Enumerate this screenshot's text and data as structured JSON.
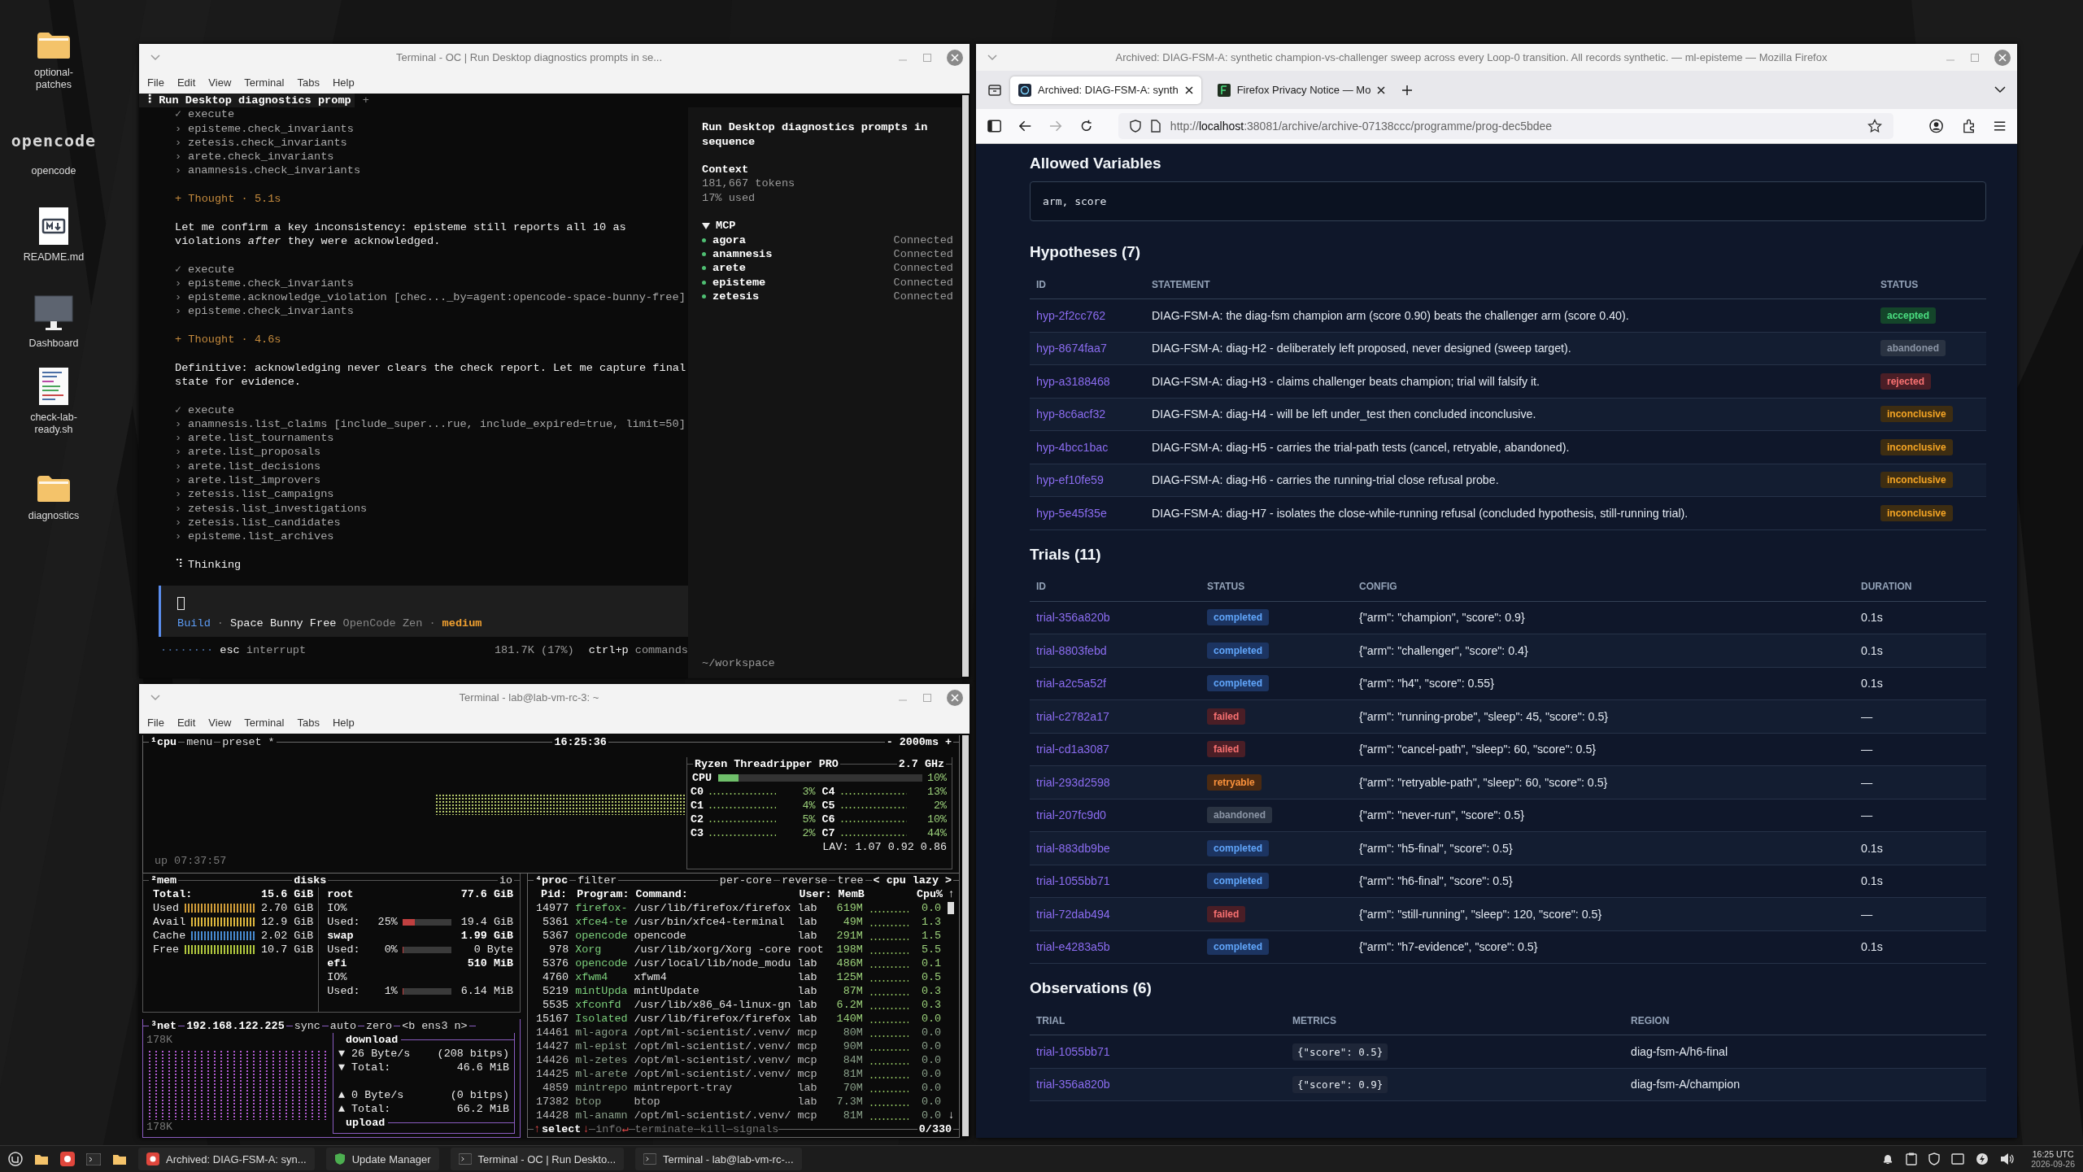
{
  "desktop": {
    "icons": [
      {
        "kind": "folder",
        "label": "optional-patches"
      },
      {
        "kind": "logo",
        "logo_text": "opencode",
        "label": "opencode"
      },
      {
        "kind": "markdown",
        "label": "README.md"
      },
      {
        "kind": "monitor",
        "label": "Dashboard"
      },
      {
        "kind": "script",
        "label": "check-lab-ready.sh"
      },
      {
        "kind": "folder",
        "label": "diagnostics"
      }
    ]
  },
  "opencode_window": {
    "title": "Terminal - OC | Run Desktop diagnostics prompts in se...",
    "menu": [
      "File",
      "Edit",
      "View",
      "Terminal",
      "Tabs",
      "Help"
    ],
    "session_tab": {
      "spinner": "⠸",
      "label": "Run Desktop diagnostics promp"
    },
    "new_tab": "+",
    "transcript": [
      {
        "kind": "execute",
        "mark": "✓",
        "text": "execute"
      },
      {
        "kind": "tool",
        "mark": "›",
        "text": "episteme.check_invariants"
      },
      {
        "kind": "tool",
        "mark": "›",
        "text": "zetesis.check_invariants"
      },
      {
        "kind": "tool",
        "mark": "›",
        "text": "arete.check_invariants"
      },
      {
        "kind": "tool",
        "mark": "›",
        "text": "anamnesis.check_invariants"
      },
      {
        "kind": "thought",
        "text": "+ Thought · 5.1s"
      },
      {
        "kind": "message",
        "text": "Let me confirm a key inconsistency: episteme still reports all 10 as violations *after* they were acknowledged."
      },
      {
        "kind": "execute",
        "mark": "✓",
        "text": "execute"
      },
      {
        "kind": "tool",
        "mark": "›",
        "text": "episteme.check_invariants"
      },
      {
        "kind": "tool",
        "mark": "›",
        "text": "episteme.acknowledge_violation [chec..._by=agent:opencode-space-bunny-free]"
      },
      {
        "kind": "tool",
        "mark": "›",
        "text": "episteme.check_invariants"
      },
      {
        "kind": "thought",
        "text": "+ Thought · 4.6s"
      },
      {
        "kind": "message",
        "text": "Definitive: acknowledging never clears the check report. Let me capture final state for evidence."
      },
      {
        "kind": "execute",
        "mark": "✓",
        "text": "execute"
      },
      {
        "kind": "tool",
        "mark": "›",
        "text": "anamnesis.list_claims [include_super...rue, include_expired=true, limit=50]"
      },
      {
        "kind": "tool",
        "mark": "›",
        "text": "arete.list_tournaments"
      },
      {
        "kind": "tool",
        "mark": "›",
        "text": "arete.list_proposals"
      },
      {
        "kind": "tool",
        "mark": "›",
        "text": "arete.list_decisions"
      },
      {
        "kind": "tool",
        "mark": "›",
        "text": "arete.list_improvers"
      },
      {
        "kind": "tool",
        "mark": "›",
        "text": "zetesis.list_campaigns"
      },
      {
        "kind": "tool",
        "mark": "›",
        "text": "zetesis.list_investigations"
      },
      {
        "kind": "tool",
        "mark": "›",
        "text": "zetesis.list_candidates"
      },
      {
        "kind": "tool",
        "mark": "›",
        "text": "episteme.list_archives"
      },
      {
        "kind": "thinking",
        "mark": "⠹",
        "text": "Thinking"
      }
    ],
    "prompt": {
      "agent": "Build",
      "separator": "·",
      "model": "Space Bunny Free",
      "provider": "OpenCode Zen",
      "variant": "medium"
    },
    "status": {
      "spinner": "········",
      "key": "esc",
      "action": "interrupt",
      "usage": "181.7K (17%)",
      "shortcut": "ctrl+p",
      "shortcut_action": "commands"
    },
    "sidebar": {
      "title": "Run Desktop diagnostics prompts in sequence",
      "context_label": "Context",
      "tokens": "181,667 tokens",
      "used": "17% used",
      "mcp": {
        "label": "MCP",
        "expanded": true,
        "servers": [
          {
            "name": "agora",
            "status": "Connected",
            "color": "#4fbf73"
          },
          {
            "name": "anamnesis",
            "status": "Connected",
            "color": "#4fbf73"
          },
          {
            "name": "arete",
            "status": "Connected",
            "color": "#4fbf73"
          },
          {
            "name": "episteme",
            "status": "Connected",
            "color": "#4fbf73"
          },
          {
            "name": "zetesis",
            "status": "Connected",
            "color": "#4fbf73"
          }
        ]
      },
      "cwd": "~/workspace"
    }
  },
  "btop_window": {
    "title": "Terminal - lab@lab-vm-rc-3: ~",
    "menu": [
      "File",
      "Edit",
      "View",
      "Terminal",
      "Tabs",
      "Help"
    ],
    "cpu": {
      "title": "¹cpu",
      "menu": "menu",
      "preset": "preset *",
      "clock": "16:25:36",
      "interval": "- 2000ms +",
      "uptime": "up 07:37:57",
      "model": "Ryzen Threadripper PRO",
      "freq": "2.7 GHz",
      "total": {
        "label": "CPU",
        "level": 0.1,
        "reading": "10%"
      },
      "cores": [
        {
          "label": "C0",
          "reading": "3%"
        },
        {
          "label": "C1",
          "reading": "4%"
        },
        {
          "label": "C2",
          "reading": "5%"
        },
        {
          "label": "C3",
          "reading": "2%"
        },
        {
          "label": "C4",
          "reading": "13%"
        },
        {
          "label": "C5",
          "reading": "2%"
        },
        {
          "label": "C6",
          "reading": "10%"
        },
        {
          "label": "C7",
          "reading": "44%"
        }
      ],
      "load": "LAV: 1.07 0.92 0.86"
    },
    "mem": {
      "title": "²mem",
      "rows": [
        {
          "label": "Total:",
          "value": "15.6 GiB"
        },
        {
          "label": "Used",
          "value": "2.70 GiB",
          "color": "#d9a33a"
        },
        {
          "label": "Avail",
          "value": "12.9 GiB",
          "color": "#e8c040"
        },
        {
          "label": "Cache",
          "value": "2.02 GiB",
          "color": "#4a8fd8"
        },
        {
          "label": "Free",
          "value": "10.7 GiB",
          "color": "#b8d040"
        }
      ]
    },
    "disks": {
      "title": "disks",
      "io": "io",
      "rows": [
        {
          "kind": "head",
          "label": "root",
          "value": "77.6 GiB"
        },
        {
          "kind": "io",
          "label": "IO%"
        },
        {
          "kind": "used",
          "label": "Used:",
          "percent": "25%",
          "level": 0.25,
          "value": "19.4 GiB"
        },
        {
          "kind": "head",
          "label": "swap",
          "value": "1.99 GiB"
        },
        {
          "kind": "used",
          "label": "Used:",
          "percent": "0%",
          "level": 0,
          "value": "0 Byte"
        },
        {
          "kind": "head",
          "label": "efi",
          "value": "510 MiB"
        },
        {
          "kind": "io",
          "label": "IO%"
        },
        {
          "kind": "used",
          "label": "Used:",
          "percent": "1%",
          "level": 0.01,
          "value": "6.14 MiB"
        }
      ]
    },
    "net": {
      "title": "³net",
      "address": "192.168.122.225",
      "options": [
        "sync",
        "auto",
        "zero"
      ],
      "interface": "<b ens3 n>",
      "scale_top": "178K",
      "scale_bottom": "178K",
      "download": {
        "label": "download",
        "rate": "▼ 26 Byte/s",
        "bits": "(208 bitps)",
        "total_label": "▼ Total:",
        "total": "46.6 MiB"
      },
      "upload": {
        "label": "upload",
        "rate": "▲ 0 Byte/s",
        "bits": "(0 bitps)",
        "total_label": "▲ Total:",
        "total": "66.2 MiB"
      }
    },
    "proc": {
      "title": "⁴proc",
      "filter": "filter",
      "options": [
        "per-core",
        "reverse",
        "tree"
      ],
      "sort": "< cpu lazy >",
      "columns": [
        "Pid:",
        "Program:",
        "Command:",
        "User:",
        "MemB",
        "Cpu%"
      ],
      "scroll_up": "↑",
      "scroll_down": "↓",
      "rows": [
        {
          "pid": "14977",
          "program": "firefox-",
          "command": "/usr/lib/firefox/firefox",
          "user": "lab",
          "mem": "619M",
          "cpu": "0.0"
        },
        {
          "pid": "5361",
          "program": "xfce4-te",
          "command": "/usr/bin/xfce4-terminal",
          "user": "lab",
          "mem": "49M",
          "cpu": "1.3"
        },
        {
          "pid": "5367",
          "program": "opencode",
          "command": "opencode",
          "user": "lab",
          "mem": "291M",
          "cpu": "1.5"
        },
        {
          "pid": "978",
          "program": "Xorg",
          "command": "/usr/lib/xorg/Xorg -core",
          "user": "root",
          "mem": "198M",
          "cpu": "5.5"
        },
        {
          "pid": "5376",
          "program": "opencode",
          "command": "/usr/local/lib/node_modu",
          "user": "lab",
          "mem": "486M",
          "cpu": "0.1"
        },
        {
          "pid": "4760",
          "program": "xfwm4",
          "command": "xfwm4",
          "user": "lab",
          "mem": "125M",
          "cpu": "0.5"
        },
        {
          "pid": "5219",
          "program": "mintUpda",
          "command": "mintUpdate",
          "user": "lab",
          "mem": "87M",
          "cpu": "0.3"
        },
        {
          "pid": "5535",
          "program": "xfconfd",
          "command": "/usr/lib/x86_64-linux-gn",
          "user": "lab",
          "mem": "6.2M",
          "cpu": "0.3"
        },
        {
          "pid": "15167",
          "program": "Isolated",
          "command": "/usr/lib/firefox/firefox",
          "user": "lab",
          "mem": "140M",
          "cpu": "0.0"
        },
        {
          "pid": "14461",
          "program": "ml-agora",
          "command": "/opt/ml-scientist/.venv/",
          "user": "mcp",
          "mem": "80M",
          "cpu": "0.0"
        },
        {
          "pid": "14427",
          "program": "ml-epist",
          "command": "/opt/ml-scientist/.venv/",
          "user": "mcp",
          "mem": "90M",
          "cpu": "0.0"
        },
        {
          "pid": "14426",
          "program": "ml-zetes",
          "command": "/opt/ml-scientist/.venv/",
          "user": "mcp",
          "mem": "84M",
          "cpu": "0.0"
        },
        {
          "pid": "14425",
          "program": "ml-arete",
          "command": "/opt/ml-scientist/.venv/",
          "user": "mcp",
          "mem": "81M",
          "cpu": "0.0"
        },
        {
          "pid": "4859",
          "program": "mintrepo",
          "command": "mintreport-tray",
          "user": "lab",
          "mem": "70M",
          "cpu": "0.0"
        },
        {
          "pid": "17382",
          "program": "btop",
          "command": "btop",
          "user": "lab",
          "mem": "7.3M",
          "cpu": "0.0"
        },
        {
          "pid": "14428",
          "program": "ml-anamn",
          "command": "/opt/ml-scientist/.venv/",
          "user": "mcp",
          "mem": "81M",
          "cpu": "0.0"
        }
      ],
      "footer": {
        "up": "↑",
        "select": "select",
        "down": "↓",
        "info": "info",
        "enter": "↵",
        "terminate": "terminate",
        "kill": "kill",
        "signals": "signals",
        "count": "0/330"
      }
    }
  },
  "browser": {
    "title": "Archived: DIAG-FSM-A: synthetic champion-vs-challenger sweep across every Loop-0 transition. All records synthetic. — ml-episteme — Mozilla Firefox",
    "tabs": [
      {
        "title": "Archived: DIAG-FSM-A: synth",
        "selected": true
      },
      {
        "title": "Firefox Privacy Notice — Mo",
        "selected": false
      }
    ],
    "url": {
      "scheme": "http://",
      "host": "localhost",
      "rest": ":38081/archive/archive-07138ccc/programme/prog-dec5bdee"
    },
    "page": {
      "allowed_variables": {
        "heading": "Allowed Variables",
        "value": "arm, score"
      },
      "hypotheses": {
        "heading": "Hypotheses (7)",
        "columns": [
          "ID",
          "STATEMENT",
          "STATUS"
        ],
        "rows": [
          {
            "id": "hyp-2f2cc762",
            "statement": "DIAG-FSM-A: the diag-fsm champion arm (score 0.90) beats the challenger arm (score 0.40).",
            "status": "accepted",
            "kind": "accepted"
          },
          {
            "id": "hyp-8674faa7",
            "statement": "DIAG-FSM-A: diag-H2 - deliberately left proposed, never designed (sweep target).",
            "status": "abandoned",
            "kind": "abandoned"
          },
          {
            "id": "hyp-a3188468",
            "statement": "DIAG-FSM-A: diag-H3 - claims challenger beats champion; trial will falsify it.",
            "status": "rejected",
            "kind": "rejected"
          },
          {
            "id": "hyp-8c6acf32",
            "statement": "DIAG-FSM-A: diag-H4 - will be left under_test then concluded inconclusive.",
            "status": "inconclusive",
            "kind": "inconclusive"
          },
          {
            "id": "hyp-4bcc1bac",
            "statement": "DIAG-FSM-A: diag-H5 - carries the trial-path tests (cancel, retryable, abandoned).",
            "status": "inconclusive",
            "kind": "inconclusive"
          },
          {
            "id": "hyp-ef10fe59",
            "statement": "DIAG-FSM-A: diag-H6 - carries the running-trial close refusal probe.",
            "status": "inconclusive",
            "kind": "inconclusive"
          },
          {
            "id": "hyp-5e45f35e",
            "statement": "DIAG-FSM-A: diag-H7 - isolates the close-while-running refusal (concluded hypothesis, still-running trial).",
            "status": "inconclusive",
            "kind": "inconclusive"
          }
        ]
      },
      "trials": {
        "heading": "Trials (11)",
        "columns": [
          "ID",
          "STATUS",
          "CONFIG",
          "DURATION"
        ],
        "rows": [
          {
            "id": "trial-356a820b",
            "status": "completed",
            "kind": "completed",
            "config": "{\"arm\": \"champion\", \"score\": 0.9}",
            "duration": "0.1s"
          },
          {
            "id": "trial-8803febd",
            "status": "completed",
            "kind": "completed",
            "config": "{\"arm\": \"challenger\", \"score\": 0.4}",
            "duration": "0.1s"
          },
          {
            "id": "trial-a2c5a52f",
            "status": "completed",
            "kind": "completed",
            "config": "{\"arm\": \"h4\", \"score\": 0.55}",
            "duration": "0.1s"
          },
          {
            "id": "trial-c2782a17",
            "status": "failed",
            "kind": "failed",
            "config": "{\"arm\": \"running-probe\", \"sleep\": 45, \"score\": 0.5}",
            "duration": "—"
          },
          {
            "id": "trial-cd1a3087",
            "status": "failed",
            "kind": "failed",
            "config": "{\"arm\": \"cancel-path\", \"sleep\": 60, \"score\": 0.5}",
            "duration": "—"
          },
          {
            "id": "trial-293d2598",
            "status": "retryable",
            "kind": "retryable",
            "config": "{\"arm\": \"retryable-path\", \"sleep\": 60, \"score\": 0.5}",
            "duration": "—"
          },
          {
            "id": "trial-207fc9d0",
            "status": "abandoned",
            "kind": "abandoned",
            "config": "{\"arm\": \"never-run\", \"score\": 0.5}",
            "duration": "—"
          },
          {
            "id": "trial-883db9be",
            "status": "completed",
            "kind": "completed",
            "config": "{\"arm\": \"h5-final\", \"score\": 0.5}",
            "duration": "0.1s"
          },
          {
            "id": "trial-1055bb71",
            "status": "completed",
            "kind": "completed",
            "config": "{\"arm\": \"h6-final\", \"score\": 0.5}",
            "duration": "0.1s"
          },
          {
            "id": "trial-72dab494",
            "status": "failed",
            "kind": "failed",
            "config": "{\"arm\": \"still-running\", \"sleep\": 120, \"score\": 0.5}",
            "duration": "—"
          },
          {
            "id": "trial-e4283a5b",
            "status": "completed",
            "kind": "completed",
            "config": "{\"arm\": \"h7-evidence\", \"score\": 0.5}",
            "duration": "0.1s"
          }
        ]
      },
      "observations": {
        "heading": "Observations (6)",
        "columns": [
          "TRIAL",
          "METRICS",
          "REGION"
        ],
        "rows": [
          {
            "trial": "trial-1055bb71",
            "metrics": "{\"score\": 0.5}",
            "region": "diag-fsm-A/h6-final"
          },
          {
            "trial": "trial-356a820b",
            "metrics": "{\"score\": 0.9}",
            "region": "diag-fsm-A/champion"
          }
        ]
      }
    }
  },
  "taskbar": {
    "windows": [
      {
        "kind": "browser",
        "title": "Archived: DIAG-FSM-A: syn..."
      },
      {
        "kind": "update",
        "title": "Update Manager"
      },
      {
        "kind": "terminal",
        "title": "Terminal - OC | Run Deskto..."
      },
      {
        "kind": "terminal",
        "title": "Terminal - lab@lab-vm-rc-..."
      }
    ],
    "time": "16:25 UTC",
    "date": "2026-09-26"
  }
}
